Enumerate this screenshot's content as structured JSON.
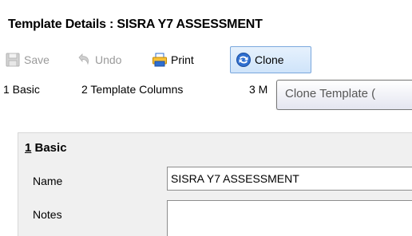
{
  "window": {
    "title": "Template Details : SISRA Y7 ASSESSMENT"
  },
  "toolbar": {
    "save_label": "Save",
    "undo_label": "Undo",
    "print_label": "Print",
    "clone_label": "Clone",
    "icons": [
      "save-icon",
      "undo-icon",
      "print-icon",
      "clone-icon"
    ]
  },
  "tabs": [
    {
      "label": "1 Basic"
    },
    {
      "label": "2 Template Columns"
    },
    {
      "label": "3 M"
    }
  ],
  "tooltip": {
    "text": "Clone Template ("
  },
  "section": {
    "number": "1",
    "title": " Basic",
    "fields": {
      "name_label": "Name",
      "name_value": "SISRA Y7 ASSESSMENT",
      "notes_label": "Notes",
      "notes_value": ""
    }
  },
  "colors": {
    "accent": "#3a7bd5",
    "clone_highlight": "#cfe4fa",
    "panel_bg": "#f0f0f0"
  }
}
